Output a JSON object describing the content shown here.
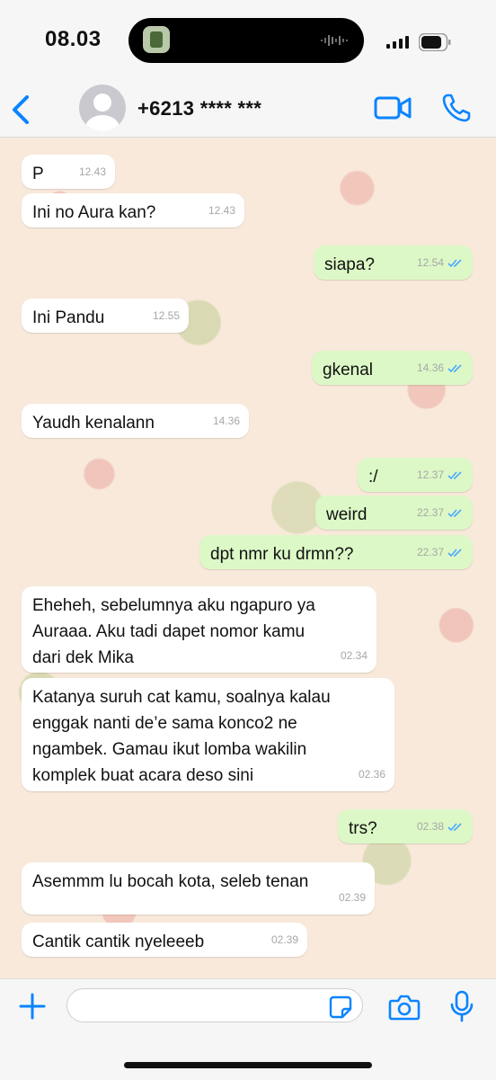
{
  "status_bar": {
    "time": "08.03"
  },
  "header": {
    "contact_name": "+6213 **** ***"
  },
  "colors": {
    "accent": "#0a84ff",
    "outgoing_bubble": "#dcf8c6",
    "incoming_bubble": "#ffffff",
    "read_ticks": "#4aa8ff"
  },
  "icons": [
    "back-chevron-icon",
    "avatar-placeholder-icon",
    "video-call-icon",
    "phone-icon",
    "plus-icon",
    "sticker-icon",
    "camera-icon",
    "microphone-icon",
    "double-check-icon"
  ],
  "messages": [
    {
      "direction": "in",
      "text": "P",
      "time": "12.43"
    },
    {
      "direction": "in",
      "text": "Ini no Aura kan?",
      "time": "12.43"
    },
    {
      "direction": "out",
      "text": "siapa?",
      "time": "12.54",
      "read": true
    },
    {
      "direction": "in",
      "text": "Ini Pandu",
      "time": "12.55"
    },
    {
      "direction": "out",
      "text": "gkenal",
      "time": "14.36",
      "read": true
    },
    {
      "direction": "in",
      "text": "Yaudh kenalann",
      "time": "14.36"
    },
    {
      "direction": "out",
      "text": ":/",
      "time": "12.37",
      "read": true
    },
    {
      "direction": "out",
      "text": "weird",
      "time": "22.37",
      "read": true
    },
    {
      "direction": "out",
      "text": "dpt nmr ku drmn??",
      "time": "22.37",
      "read": true
    },
    {
      "direction": "in",
      "text": "Eheheh, sebelumnya aku ngapuro ya\nAuraaa. Aku tadi dapet nomor kamu\ndari dek Mika",
      "time": "02.34"
    },
    {
      "direction": "in",
      "text": "Katanya suruh cat kamu, soalnya kalau\nenggak nanti de’e sama konco2 ne\nngambek. Gamau ikut lomba wakilin\nkomplek buat acara deso sini",
      "time": "02.36"
    },
    {
      "direction": "out",
      "text": "trs?",
      "time": "02.38",
      "read": true
    },
    {
      "direction": "in",
      "text": "Asemmm lu bocah kota, seleb tenan",
      "time": "02.39"
    },
    {
      "direction": "in",
      "text": "Cantik cantik nyeleeeb",
      "time": "02.39"
    }
  ],
  "composer": {
    "input_value": ""
  }
}
